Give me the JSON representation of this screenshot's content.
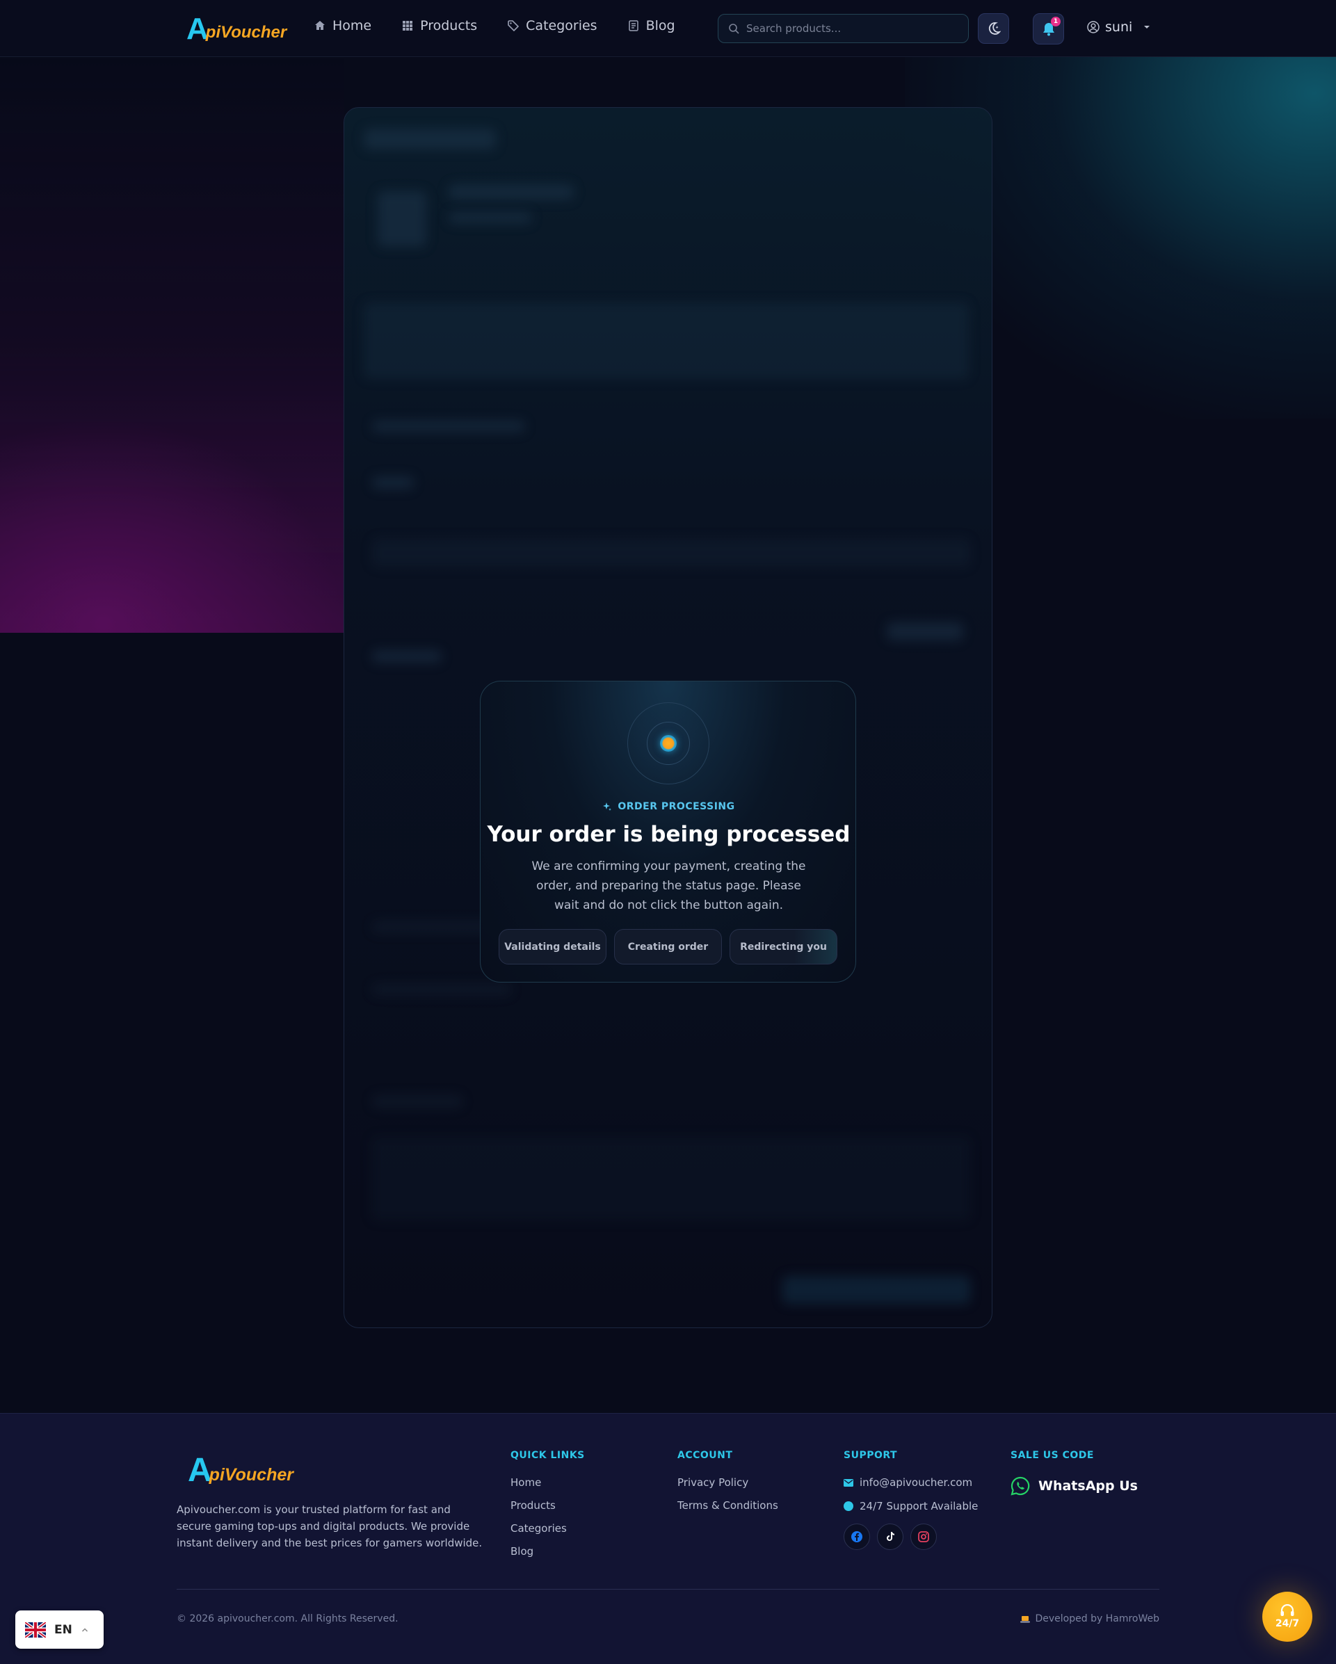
{
  "header": {
    "logo": {
      "a": "A",
      "rest": "piVoucher"
    },
    "nav": [
      {
        "label": "Home",
        "icon": "home-icon"
      },
      {
        "label": "Products",
        "icon": "grid-icon"
      },
      {
        "label": "Categories",
        "icon": "tag-icon"
      },
      {
        "label": "Blog",
        "icon": "document-icon"
      }
    ],
    "search_placeholder": "Search products...",
    "notification_count": "1",
    "user_name": "suni"
  },
  "modal": {
    "kicker": "ORDER PROCESSING",
    "title": "Your order is being processed",
    "description": "We are confirming your payment, creating the order, and preparing the status page. Please wait and do not click the button again.",
    "steps": [
      "Validating details",
      "Creating order",
      "Redirecting you"
    ]
  },
  "footer": {
    "logo": {
      "a": "A",
      "rest": "piVoucher"
    },
    "description": "Apivoucher.com is your trusted platform for fast and secure gaming top-ups and digital products. We provide instant delivery and the best prices for gamers worldwide.",
    "quick_links": {
      "heading": "QUICK LINKS",
      "items": [
        "Home",
        "Products",
        "Categories",
        "Blog"
      ]
    },
    "account": {
      "heading": "ACCOUNT",
      "items": [
        "Privacy Policy",
        "Terms & Conditions"
      ]
    },
    "support": {
      "heading": "SUPPORT",
      "email": "info@apivoucher.com",
      "availability": "24/7 Support Available"
    },
    "sale": {
      "heading": "SALE US CODE",
      "whatsapp": "WhatsApp Us"
    },
    "copyright": "© 2026 apivoucher.com. All Rights Reserved.",
    "developer": "Developed by HamroWeb"
  },
  "language": {
    "code": "EN"
  },
  "support_button": {
    "label": "24/7"
  },
  "colors": {
    "accent": "#2ec7e8",
    "brand_orange": "#f5a623",
    "background": "#080b1a",
    "badge": "#e8308a"
  }
}
